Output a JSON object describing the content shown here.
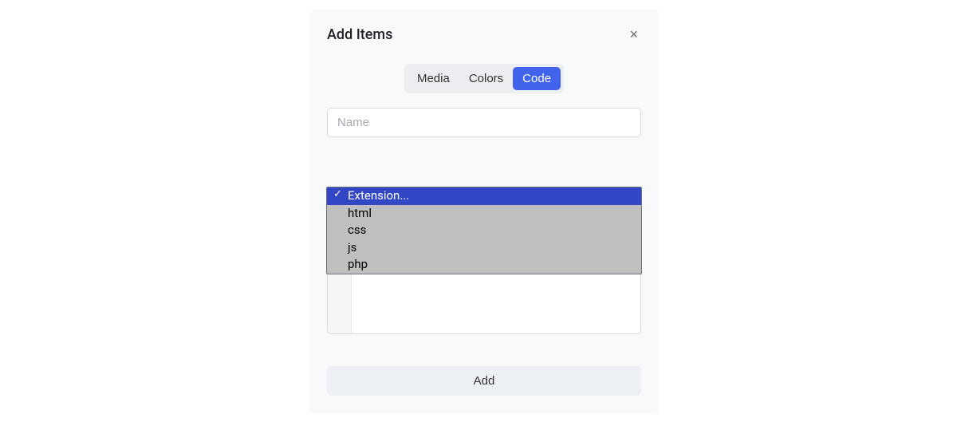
{
  "modal": {
    "title": "Add Items",
    "close_icon": "×"
  },
  "tabs": {
    "items": [
      {
        "label": "Media",
        "active": false
      },
      {
        "label": "Colors",
        "active": false
      },
      {
        "label": "Code",
        "active": true
      }
    ]
  },
  "name_input": {
    "placeholder": "Name",
    "value": ""
  },
  "extension_select": {
    "placeholder": "Extension...",
    "options": [
      {
        "label": "Extension...",
        "selected": true
      },
      {
        "label": "html",
        "selected": false
      },
      {
        "label": "css",
        "selected": false
      },
      {
        "label": "js",
        "selected": false
      },
      {
        "label": "php",
        "selected": false
      }
    ]
  },
  "footer": {
    "add_label": "Add"
  }
}
